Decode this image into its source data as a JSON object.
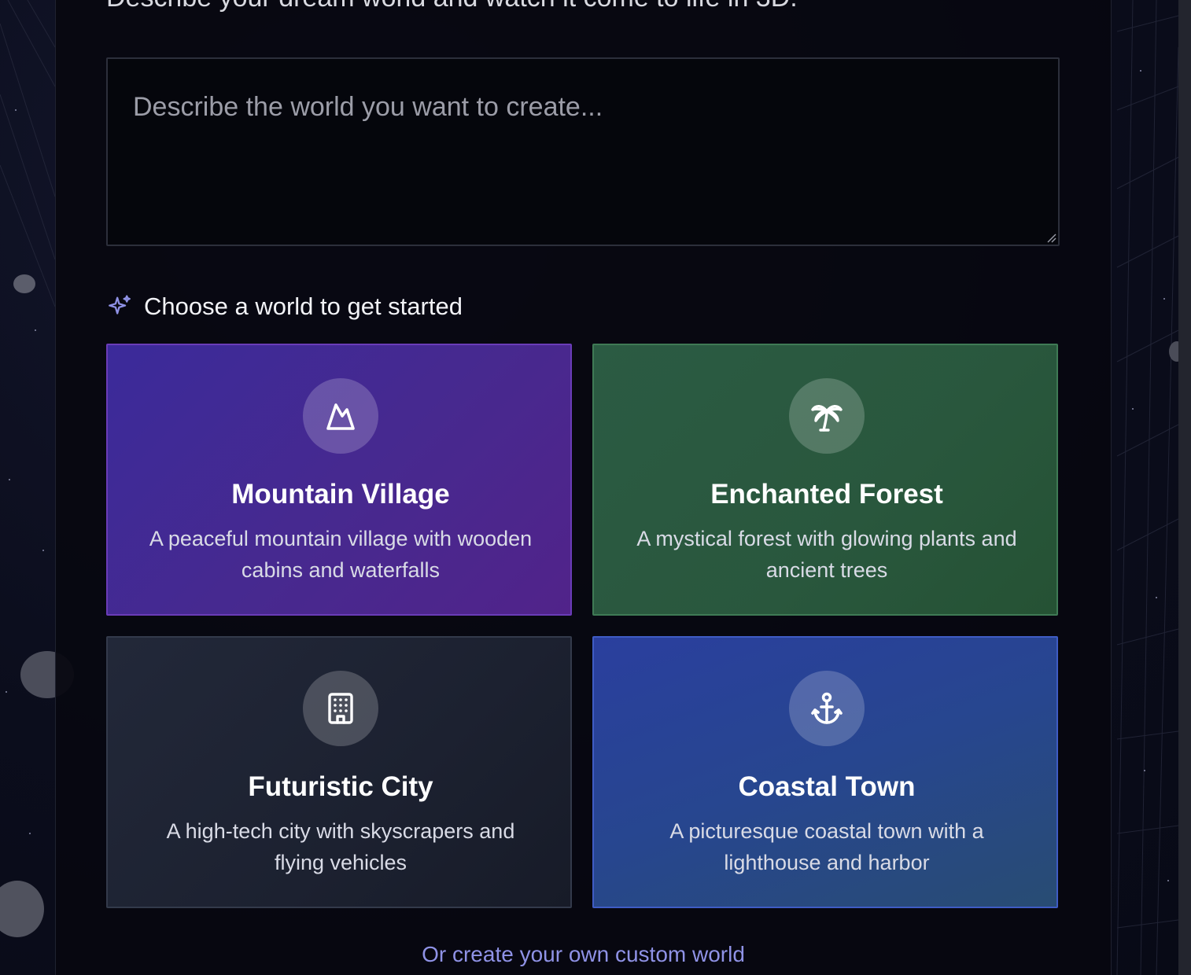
{
  "header": {
    "subtitle": "Describe your dream world and watch it come to life in 3D."
  },
  "prompt": {
    "placeholder": "Describe the world you want to create...",
    "value": ""
  },
  "section": {
    "icon": "sparkles-icon",
    "title": "Choose a world to get started"
  },
  "worlds": [
    {
      "icon": "mountain-icon",
      "title": "Mountain Village",
      "description": "A peaceful mountain village with wooden cabins and waterfalls",
      "color": "#47298f"
    },
    {
      "icon": "palm-tree-icon",
      "title": "Enchanted Forest",
      "description": "A mystical forest with glowing plants and ancient trees",
      "color": "#29573d"
    },
    {
      "icon": "building-icon",
      "title": "Futuristic City",
      "description": "A high-tech city with skyscrapers and flying vehicles",
      "color": "#1c2130"
    },
    {
      "icon": "anchor-icon",
      "title": "Coastal Town",
      "description": "A picturesque coastal town with a lighthouse and harbor",
      "color": "#27468f"
    }
  ],
  "custom_link": "Or create your own custom world",
  "colors": {
    "background": "#0a0c1a",
    "panel": "#070810",
    "accent_link": "#8f92e6",
    "sparkle": "#8f92e6"
  }
}
